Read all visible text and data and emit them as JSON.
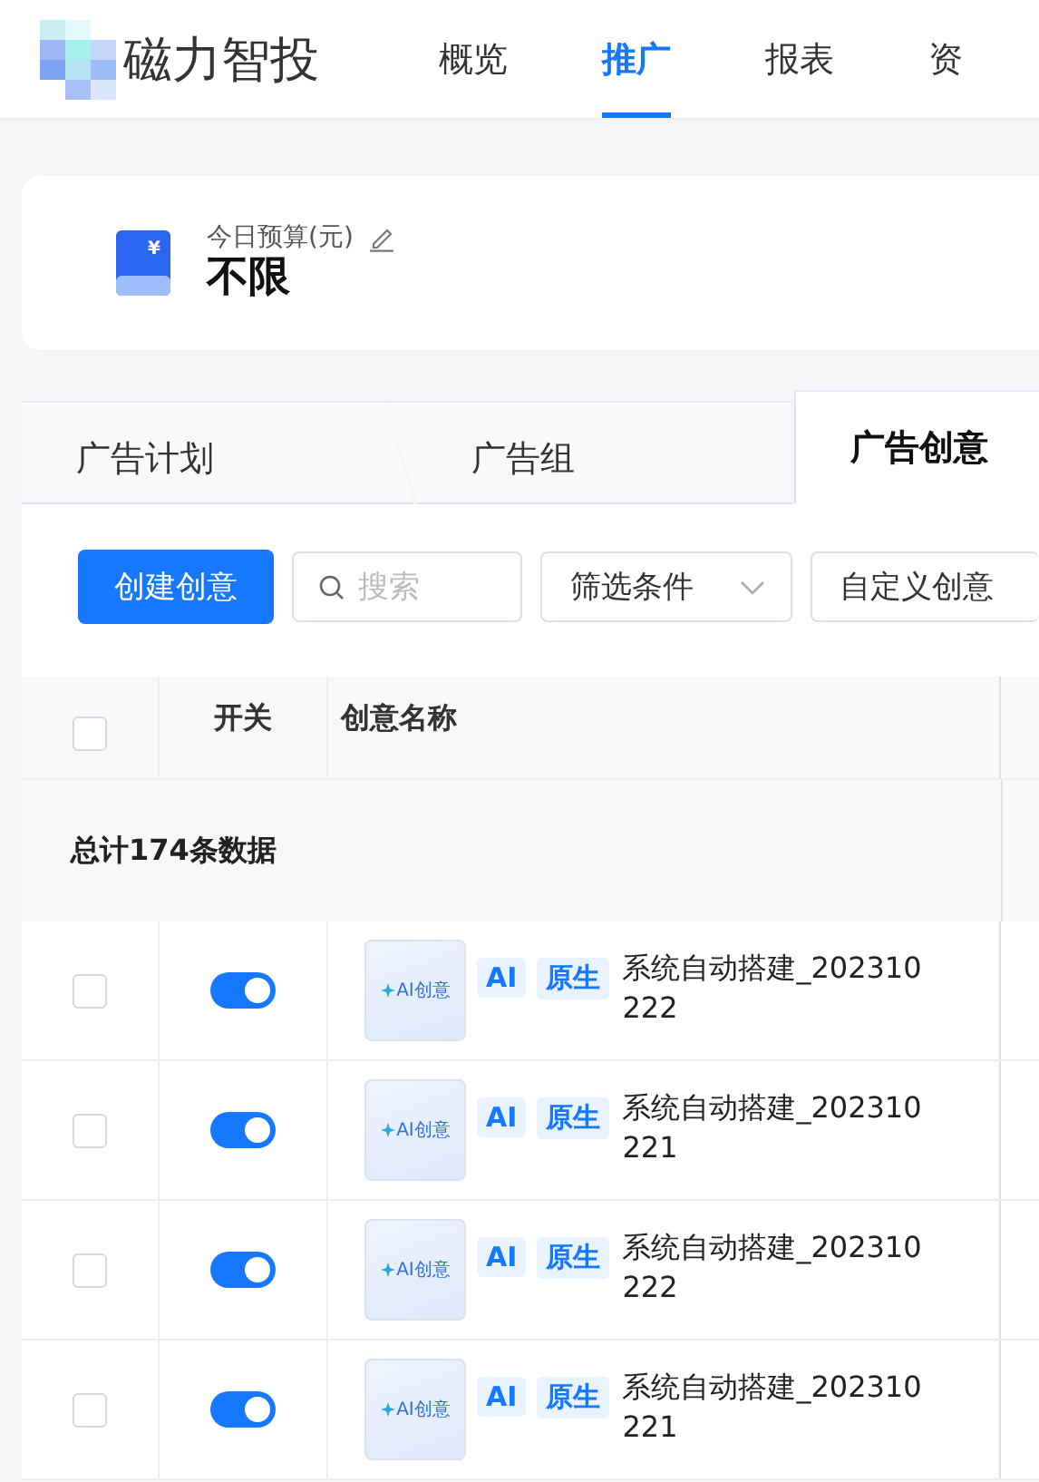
{
  "logo": {
    "name": "磁力智投"
  },
  "nav": [
    {
      "label": "概览",
      "selected": false
    },
    {
      "label": "推广",
      "selected": true
    },
    {
      "label": "报表",
      "selected": false
    },
    {
      "label": "资",
      "selected": false
    }
  ],
  "budget": {
    "icon_symbol": "¥",
    "label": "今日预算(元)",
    "value": "不限"
  },
  "tabs": [
    {
      "label": "广告计划",
      "selected": false
    },
    {
      "label": "广告组",
      "selected": false
    },
    {
      "label": "广告创意",
      "selected": true
    }
  ],
  "toolbar": {
    "create_button": "创建创意",
    "search": {
      "placeholder": "搜索"
    },
    "filter": "筛选条件",
    "custom_button": "自定义创意"
  },
  "table": {
    "select_all_checked": false,
    "columns": [
      "开关",
      "创意名称"
    ],
    "summary": "总计174条数据",
    "rows": [
      {
        "checked": false,
        "on": true,
        "thumb_label": "AI创意",
        "tags": [
          "AI",
          "原生"
        ],
        "name": "系统自动搭建_202310222"
      },
      {
        "checked": false,
        "on": true,
        "thumb_label": "AI创意",
        "tags": [
          "AI",
          "原生"
        ],
        "name": "系统自动搭建_202310221"
      },
      {
        "checked": false,
        "on": true,
        "thumb_label": "AI创意",
        "tags": [
          "AI",
          "原生"
        ],
        "name": "系统自动搭建_202310222"
      },
      {
        "checked": false,
        "on": true,
        "thumb_label": "AI创意",
        "tags": [
          "AI",
          "原生"
        ],
        "name": "系统自动搭建_202310221"
      }
    ]
  }
}
